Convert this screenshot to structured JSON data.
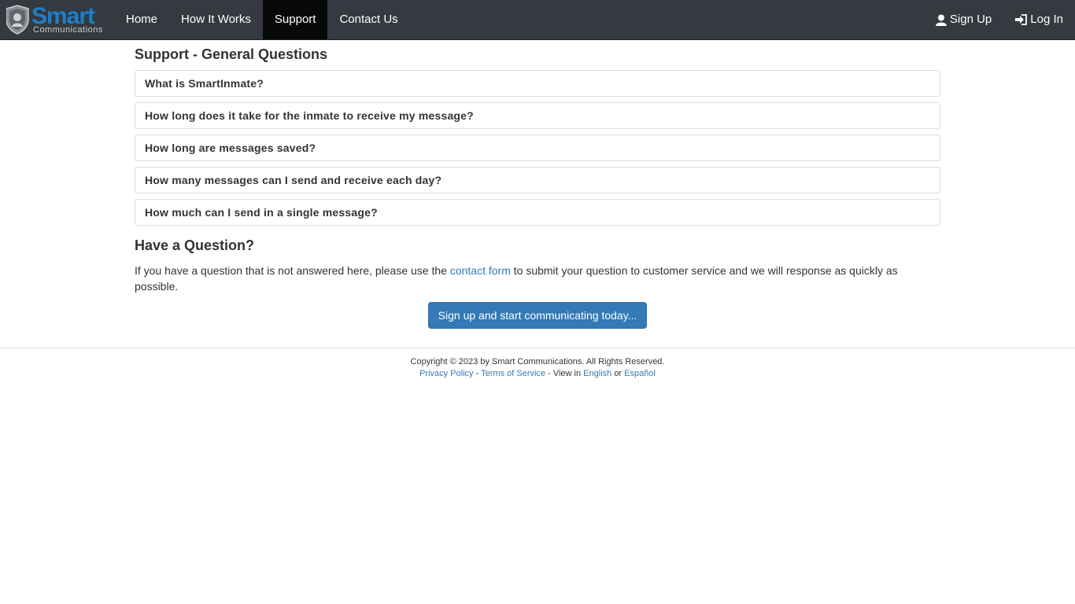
{
  "brand": {
    "logo_word": "Smart",
    "logo_sub": "Communications"
  },
  "nav": {
    "left": [
      {
        "label": "Home"
      },
      {
        "label": "How It Works"
      },
      {
        "label": "Support",
        "active": true
      },
      {
        "label": "Contact Us"
      }
    ],
    "right": [
      {
        "label": "Sign Up",
        "icon": "user-icon"
      },
      {
        "label": "Log In",
        "icon": "login-icon"
      }
    ]
  },
  "main": {
    "title": "Support - General Questions",
    "faqs": [
      "What is SmartInmate?",
      "How long does it take for the inmate to receive my message?",
      "How long are messages saved?",
      "How many messages can I send and receive each day?",
      "How much can I send in a single message?"
    ],
    "question_heading": "Have a Question?",
    "question_text_before": "If you have a question that is not answered here, please use the",
    "question_link": "contact form",
    "question_text_after": "to submit your question to customer service and we will response as quickly as possible.",
    "cta_button": "Sign up and start communicating today..."
  },
  "footer": {
    "copyright": "Copyright © 2023 by Smart Communications. All Rights Reserved.",
    "privacy": "Privacy Policy",
    "sep1": "-",
    "terms": "Terms of Service",
    "view_in": "- View in",
    "english": "English",
    "or": "or",
    "espanol": "Español"
  },
  "colors": {
    "navbar_bg": "#343a40",
    "active_nav_bg": "#080808",
    "brand_blue": "#1e7fc7",
    "link": "#337ab7",
    "button": "#337ab7"
  }
}
